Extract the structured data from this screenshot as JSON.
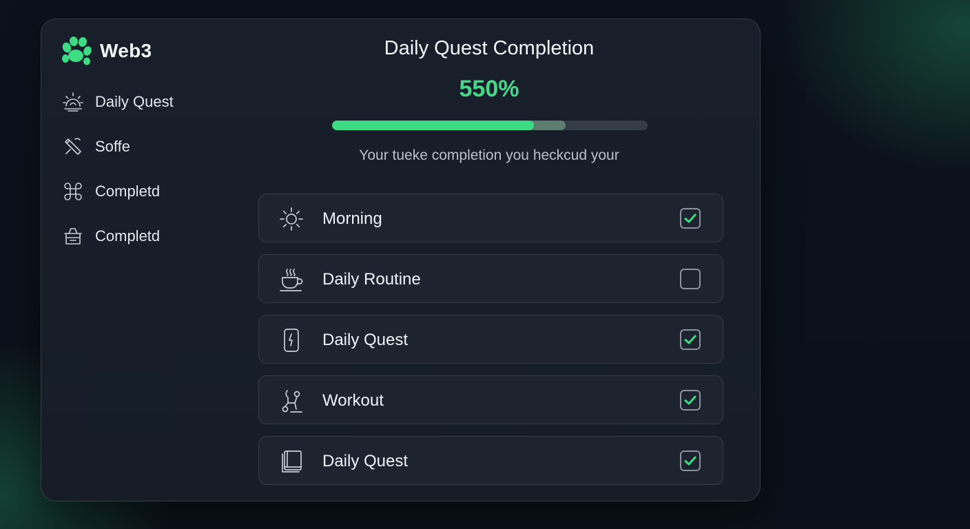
{
  "brand": {
    "name": "Web3",
    "accent": "#3ddc84",
    "logo_icon": "green-paw-logo"
  },
  "sidebar": {
    "items": [
      {
        "label": "Daily Quest",
        "icon": "sunrise-icon"
      },
      {
        "label": "Soffe",
        "icon": "tools-icon"
      },
      {
        "label": "Completd",
        "icon": "command-icon"
      },
      {
        "label": "Completd",
        "icon": "basket-icon"
      }
    ]
  },
  "main": {
    "title": "Daily Quest Completion",
    "percent_label": "550%",
    "progress_fraction": 0.64,
    "progress_buffer_fraction": 0.74,
    "subtitle": "Your tueke completion you heckcud your"
  },
  "tasks": [
    {
      "label": "Morning",
      "icon": "sun-icon",
      "checked": true
    },
    {
      "label": "Daily Routine",
      "icon": "coffee-cup-icon",
      "checked": false
    },
    {
      "label": "Daily Quest",
      "icon": "phone-icon",
      "checked": true
    },
    {
      "label": "Workout",
      "icon": "exercise-icon",
      "checked": true
    },
    {
      "label": "Daily Quest",
      "icon": "book-icon",
      "checked": true
    }
  ]
}
